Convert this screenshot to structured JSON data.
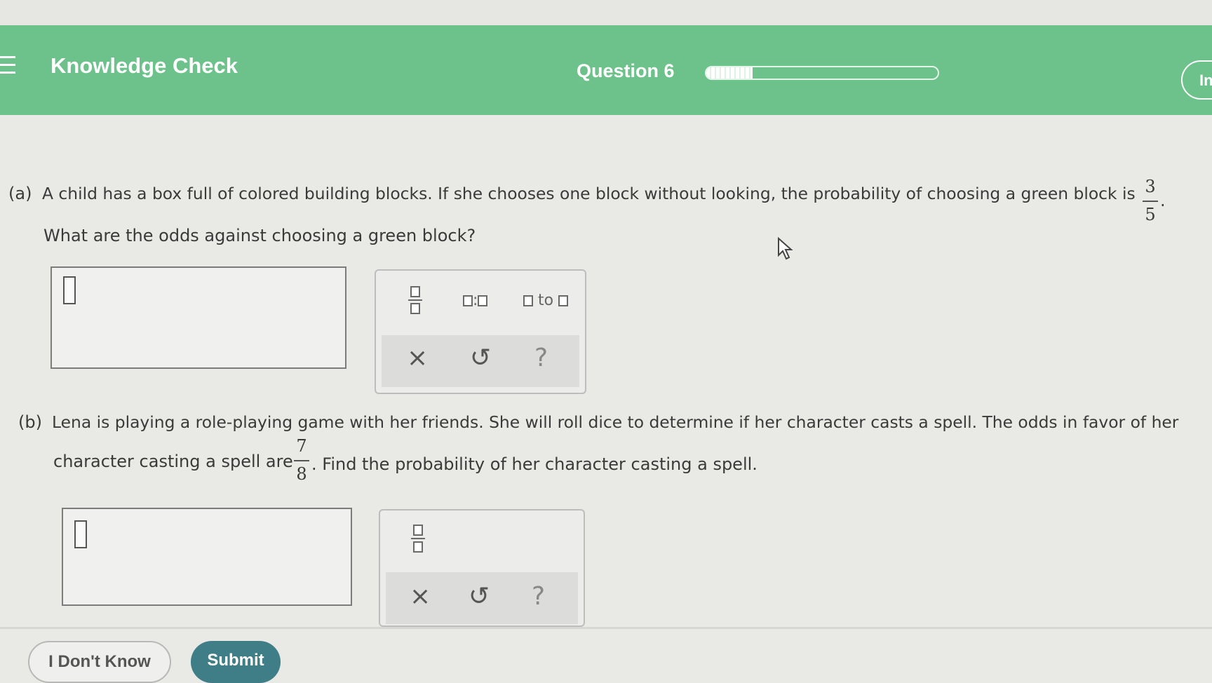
{
  "header": {
    "app_title": "Knowledge Check",
    "question_label": "Question 6",
    "progress_fraction": 0.2,
    "corner_button_label": "In",
    "accent_color": "#6cc28a"
  },
  "part_a": {
    "label": "(a)",
    "line1": "A child has a box full of colored building blocks. If she chooses one block without looking, the probability of choosing a green block is",
    "frac_num": "3",
    "frac_den": "5",
    "line2": "What are the odds against choosing a green block?",
    "tools": {
      "ratio": ":",
      "to": "to",
      "clear": "×",
      "undo": "↺",
      "help": "?"
    }
  },
  "part_b": {
    "label": "(b)",
    "line1": "Lena is playing a role-playing game with her friends. She will roll dice to determine if her character casts a spell. The odds in favor of her",
    "line2_pre": "character casting a spell are",
    "frac_num": "7",
    "frac_den": "8",
    "line2_post": ". Find the probability of her character casting a spell.",
    "tools": {
      "clear": "×",
      "undo": "↺",
      "help": "?"
    }
  },
  "footer": {
    "dont_know_label": "I Don't Know",
    "submit_label": "Submit",
    "submit_color": "#3f7e86"
  }
}
